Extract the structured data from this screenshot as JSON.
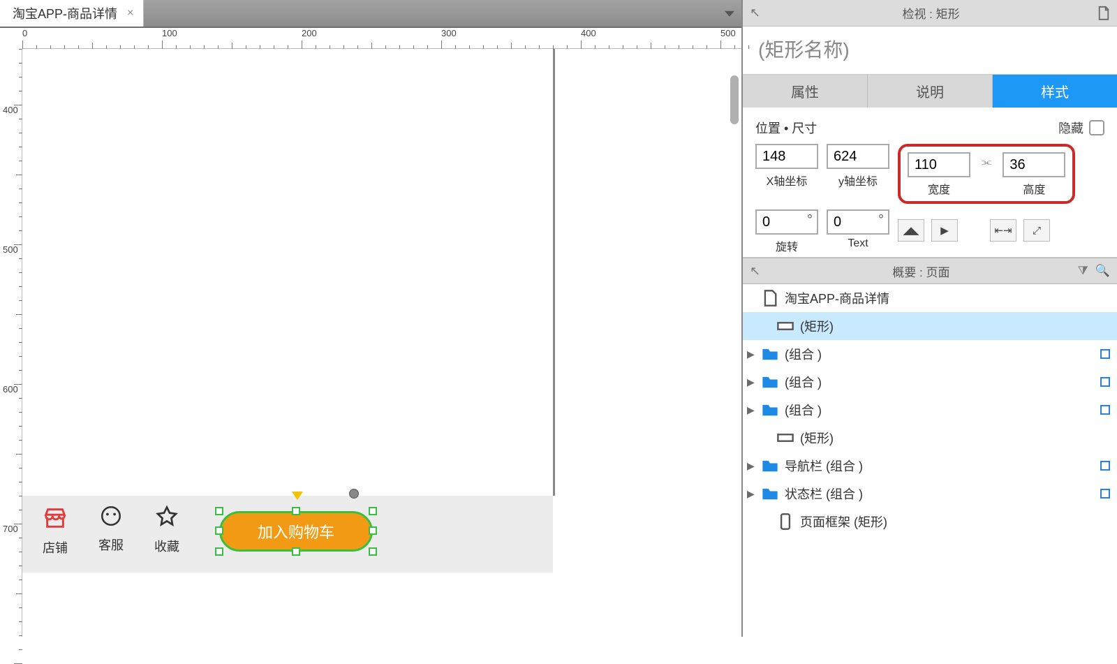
{
  "tab": {
    "title": "淘宝APP-商品详情",
    "close_glyph": "×"
  },
  "ruler": {
    "h_majors": [
      0,
      100,
      200,
      300,
      400,
      500
    ],
    "v_majors": [
      400,
      500,
      600,
      700
    ]
  },
  "bottom_bar": {
    "items": [
      {
        "icon": "store-icon",
        "label": "店铺"
      },
      {
        "icon": "service-icon",
        "label": "客服"
      },
      {
        "icon": "star-icon",
        "label": "收藏"
      }
    ],
    "cart_label": "加入购物车"
  },
  "inspector": {
    "title": "检视 : 矩形",
    "name_placeholder": "(矩形名称)",
    "tabs": {
      "attr": "属性",
      "notes": "说明",
      "style": "样式"
    },
    "section": {
      "pos_size": "位置 • 尺寸",
      "hide": "隐藏",
      "x": "148",
      "x_label": "X轴坐标",
      "y": "624",
      "y_label": "y轴坐标",
      "w": "110",
      "w_label": "宽度",
      "h": "36",
      "h_label": "高度",
      "link_glyph": "�〔〕",
      "rot": "0",
      "rot_label": "旋转",
      "textrot": "0",
      "textrot_label": "Text"
    }
  },
  "outline": {
    "title": "概要 : 页面",
    "items": [
      {
        "indent": 0,
        "caret": "",
        "icon": "page",
        "label": "淘宝APP-商品详情",
        "master": false,
        "selected": false
      },
      {
        "indent": 1,
        "caret": "",
        "icon": "rect",
        "label": "(矩形)",
        "master": false,
        "selected": true
      },
      {
        "indent": 0,
        "caret": "▶",
        "icon": "folder",
        "label": "(组合 )",
        "master": true,
        "selected": false
      },
      {
        "indent": 0,
        "caret": "▶",
        "icon": "folder",
        "label": "(组合 )",
        "master": true,
        "selected": false
      },
      {
        "indent": 0,
        "caret": "▶",
        "icon": "folder",
        "label": "(组合 )",
        "master": true,
        "selected": false
      },
      {
        "indent": 1,
        "caret": "",
        "icon": "rect",
        "label": "(矩形)",
        "master": false,
        "selected": false
      },
      {
        "indent": 0,
        "caret": "▶",
        "icon": "folder",
        "label": "导航栏 (组合 )",
        "master": true,
        "selected": false
      },
      {
        "indent": 0,
        "caret": "▶",
        "icon": "folder",
        "label": "状态栏 (组合 )",
        "master": true,
        "selected": false
      },
      {
        "indent": 1,
        "caret": "",
        "icon": "phone",
        "label": "页面框架 (矩形)",
        "master": false,
        "selected": false
      }
    ]
  }
}
